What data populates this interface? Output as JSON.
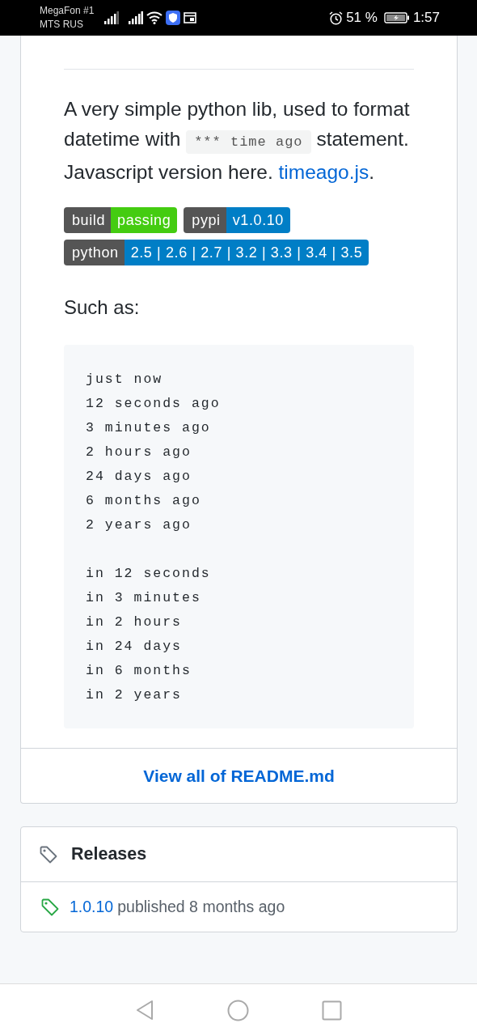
{
  "status_bar": {
    "carriers": [
      "MegaFon #1",
      "MTS RUS"
    ],
    "battery_text": "51 %",
    "time": "1:57"
  },
  "readme": {
    "description": [
      {
        "kind": "text",
        "text": "A very simple python lib, used to format datetime with "
      },
      {
        "kind": "code",
        "text": "*** time ago"
      },
      {
        "kind": "text",
        "text": " statement. Javascript version here. "
      },
      {
        "kind": "link",
        "text": "timeago.js"
      },
      {
        "kind": "text",
        "text": "."
      }
    ],
    "badge_rows": [
      [
        {
          "label": "build",
          "value": "passing",
          "color": "#44cc11"
        },
        {
          "label": "pypi",
          "value": "v1.0.10",
          "color": "#007ec6"
        }
      ],
      [
        {
          "label": "python",
          "value": "2.5 | 2.6 | 2.7 | 3.2 | 3.3 | 3.4 | 3.5",
          "color": "#007ec6"
        }
      ]
    ],
    "examples_heading": "Such as:",
    "code_groups": [
      [
        "just now",
        "12 seconds ago",
        "3 minutes ago",
        "2 hours ago",
        "24 days ago",
        "6 months ago",
        "2 years ago"
      ],
      [
        "in 12 seconds",
        "in 3 minutes",
        "in 2 hours",
        "in 24 days",
        "in 6 months",
        "in 2 years"
      ]
    ],
    "view_all": "View all of README.md"
  },
  "releases": {
    "title": "Releases",
    "items": [
      {
        "version": "1.0.10",
        "text": "published 8 months ago"
      }
    ]
  }
}
